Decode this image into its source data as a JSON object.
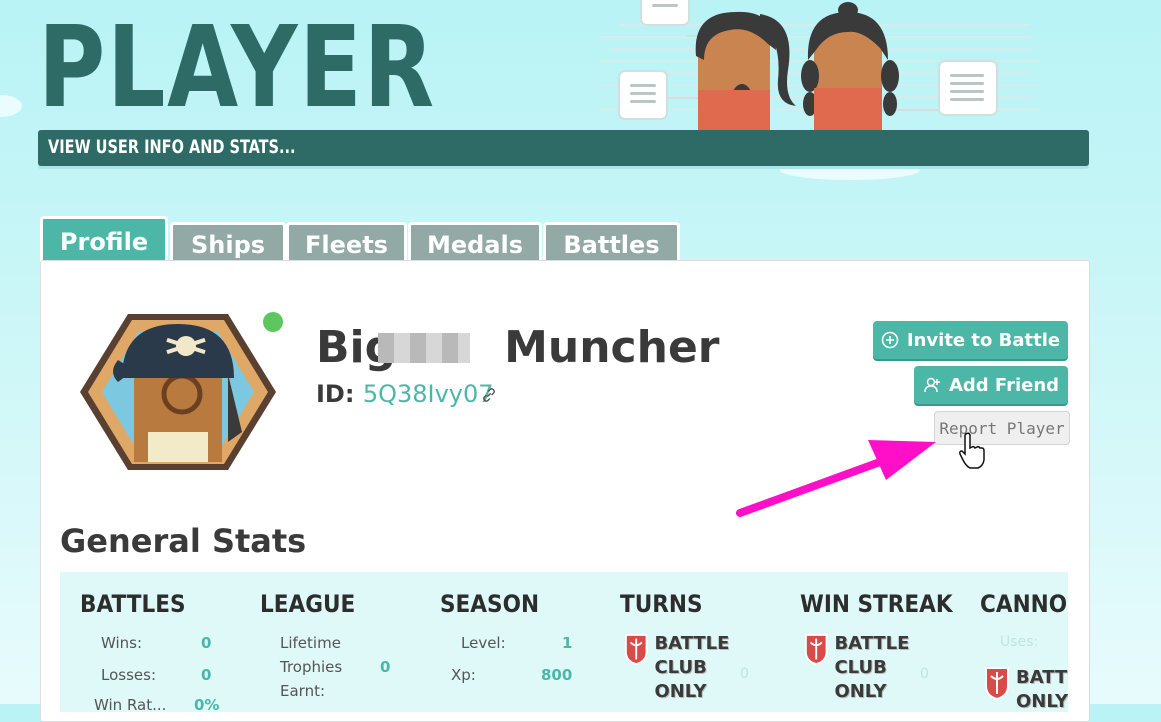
{
  "header": {
    "title": "PLAYER",
    "subtitle": "VIEW USER INFO AND STATS..."
  },
  "tabs": [
    {
      "label": "Profile",
      "active": true
    },
    {
      "label": "Ships",
      "active": false
    },
    {
      "label": "Fleets",
      "active": false
    },
    {
      "label": "Medals",
      "active": false
    },
    {
      "label": "Battles",
      "active": false
    }
  ],
  "profile": {
    "name_first": "Big",
    "name_last": "Muncher",
    "id_label": "ID:",
    "id_value": "5Q38Ivy07",
    "online": true,
    "online_color": "#5cc75e"
  },
  "actions": {
    "invite_label": "Invite to Battle",
    "add_friend_label": "Add Friend",
    "report_label": "Report Player"
  },
  "stats": {
    "title": "General Stats",
    "columns": [
      {
        "heading": "BATTLES",
        "rows": [
          {
            "label": "Wins:",
            "value": "0"
          },
          {
            "label": "Losses:",
            "value": "0"
          },
          {
            "label": "Win Rat...",
            "value": "0%"
          }
        ]
      },
      {
        "heading": "LEAGUE",
        "rows": [
          {
            "label": "Lifetime",
            "value": ""
          },
          {
            "label": "Trophies",
            "value": "0"
          },
          {
            "label": "Earnt:",
            "value": ""
          }
        ]
      },
      {
        "heading": "SEASON",
        "rows": [
          {
            "label": "Level:",
            "value": "1"
          },
          {
            "label": "Xp:",
            "value": "800"
          }
        ]
      },
      {
        "heading": "TURNS",
        "locked_text_1": "BATTLE CLUB",
        "locked_text_2": "ONLY",
        "ghost_value": "0"
      },
      {
        "heading": "WIN STREAK",
        "locked_text_1": "BATTLE CLUB",
        "locked_text_2": "ONLY",
        "ghost_value": "0"
      },
      {
        "heading": "CANNON",
        "ghost_label": "Uses:",
        "locked_text_1": "BATTL",
        "locked_text_2": "ONLY"
      }
    ]
  },
  "colors": {
    "accent": "#4cb7a7",
    "dark_teal": "#2f6b66",
    "annotation_arrow": "#ff10c8"
  }
}
